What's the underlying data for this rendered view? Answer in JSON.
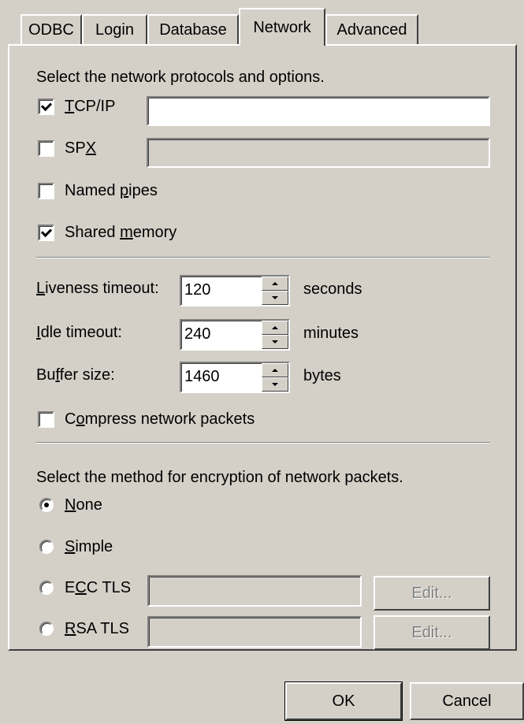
{
  "tabs": [
    "ODBC",
    "Login",
    "Database",
    "Network",
    "Advanced"
  ],
  "active_tab": "Network",
  "protocols_heading": "Select the network protocols and options.",
  "protocols": [
    {
      "label": "TCP/IP",
      "checked": true,
      "field_value": "",
      "field_enabled": true
    },
    {
      "label": "SPX",
      "checked": false,
      "field_value": "",
      "field_enabled": false
    },
    {
      "label": "Named pipes",
      "checked": false
    },
    {
      "label": "Shared memory",
      "checked": true
    }
  ],
  "timeouts": [
    {
      "label": "Liveness timeout:",
      "value": "120",
      "unit": "seconds"
    },
    {
      "label": "Idle timeout:",
      "value": "240",
      "unit": "minutes"
    },
    {
      "label": "Buffer size:",
      "value": "1460",
      "unit": "bytes"
    }
  ],
  "compress": {
    "label": "Compress network packets",
    "checked": false
  },
  "encryption_heading": "Select the method for encryption of network packets.",
  "encryption": [
    {
      "label": "None",
      "checked": true
    },
    {
      "label": "Simple",
      "checked": false
    },
    {
      "label": "ECC TLS",
      "checked": false,
      "field_value": "",
      "button": "Edit..."
    },
    {
      "label": "RSA TLS",
      "checked": false,
      "field_value": "",
      "button": "Edit..."
    }
  ],
  "buttons": {
    "ok": "OK",
    "cancel": "Cancel"
  }
}
